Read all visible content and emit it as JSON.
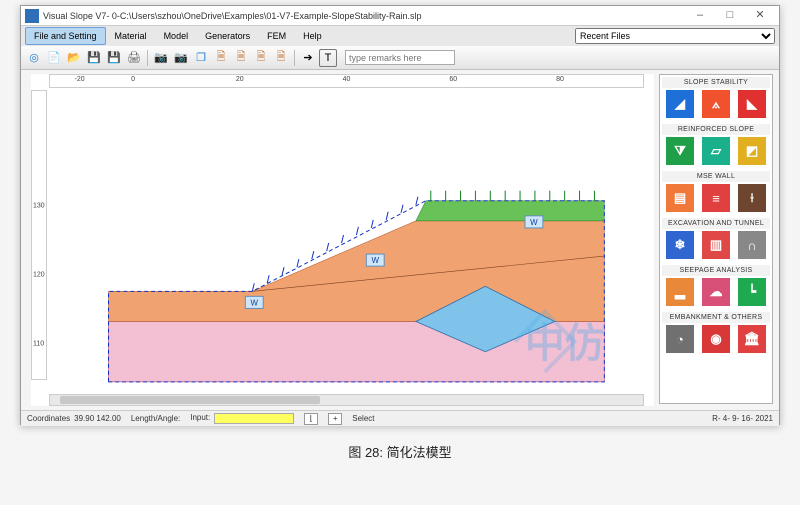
{
  "window": {
    "title": "Visual Slope V7- 0-C:\\Users\\szhou\\OneDrive\\Examples\\01-V7-Example-SlopeStability-Rain.slp",
    "min": "–",
    "max": "□",
    "close": "✕"
  },
  "menu": {
    "items": [
      "File and Setting",
      "Material",
      "Model",
      "Generators",
      "FEM",
      "Help"
    ],
    "active_index": 0,
    "recent_label": "Recent Files"
  },
  "toolbar": {
    "remark_placeholder": "type remarks here"
  },
  "ruler_h": {
    "ticks": [
      "-20",
      "0",
      "20",
      "40",
      "60",
      "80"
    ]
  },
  "ruler_v": {
    "ticks": [
      "130",
      "120",
      "110"
    ]
  },
  "side_panel": {
    "groups": [
      {
        "head": "SLOPE STABILITY"
      },
      {
        "head": "REINFORCED SLOPE"
      },
      {
        "head": "MSE WALL"
      },
      {
        "head": "EXCAVATION AND TUNNEL"
      },
      {
        "head": "SEEPAGE ANALYSIS"
      },
      {
        "head": "EMBANKMENT & OTHERS"
      }
    ]
  },
  "status": {
    "coord_label": "Coordinates",
    "coord_value": "39.90  142.00",
    "len_label": "Length/Angle:",
    "input_label": "Input:",
    "select_label": "Select",
    "date": "R- 4- 9- 16- 2021"
  },
  "drawing": {
    "w_label": "W"
  },
  "caption": "图 28: 简化法模型",
  "watermark": "中仿"
}
